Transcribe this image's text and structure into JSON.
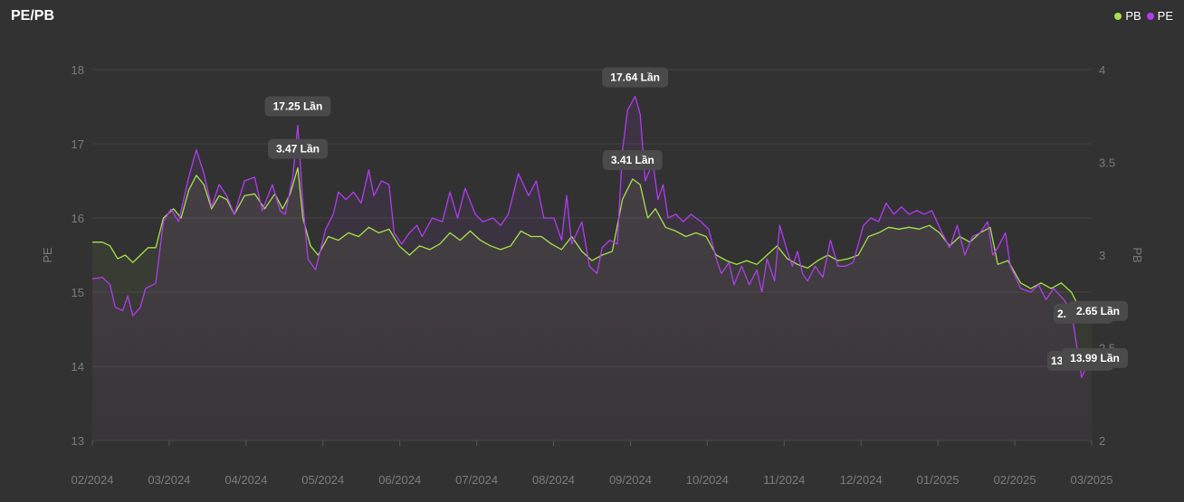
{
  "title": "PE/PB",
  "legend": [
    {
      "name": "PB",
      "color": "#a6e34a"
    },
    {
      "name": "PE",
      "color": "#b03cf0"
    }
  ],
  "chart_data": {
    "type": "line",
    "title": "PE/PB",
    "x_ticks": [
      "02/2024",
      "03/2024",
      "04/2024",
      "05/2024",
      "06/2024",
      "07/2024",
      "08/2024",
      "09/2024",
      "10/2024",
      "11/2024",
      "12/2024",
      "01/2025",
      "02/2025",
      "03/2025"
    ],
    "x_range": [
      "2024-02-01",
      "2025-03-01"
    ],
    "y_left": {
      "label": "PE",
      "ticks": [
        13,
        14,
        15,
        16,
        17,
        18
      ],
      "range": [
        13,
        18
      ]
    },
    "y_right": {
      "label": "PB",
      "ticks": [
        "2",
        "2.5",
        "3",
        "3.5",
        "4"
      ],
      "range": [
        2,
        4
      ]
    },
    "grid": true,
    "legend_position": "top-right",
    "series": [
      {
        "name": "PE",
        "axis": "left",
        "color": "#b03cf0",
        "points": [
          [
            "2024-02-01",
            15.18
          ],
          [
            "2024-02-05",
            15.2
          ],
          [
            "2024-02-08",
            15.1
          ],
          [
            "2024-02-10",
            14.8
          ],
          [
            "2024-02-13",
            14.75
          ],
          [
            "2024-02-15",
            14.95
          ],
          [
            "2024-02-17",
            14.68
          ],
          [
            "2024-02-20",
            14.8
          ],
          [
            "2024-02-22",
            15.05
          ],
          [
            "2024-02-26",
            15.12
          ],
          [
            "2024-02-29",
            15.95
          ],
          [
            "2024-03-03",
            16.12
          ],
          [
            "2024-03-06",
            15.95
          ],
          [
            "2024-03-10",
            16.55
          ],
          [
            "2024-03-13",
            16.92
          ],
          [
            "2024-03-16",
            16.6
          ],
          [
            "2024-03-19",
            16.15
          ],
          [
            "2024-03-22",
            16.45
          ],
          [
            "2024-03-25",
            16.3
          ],
          [
            "2024-03-28",
            16.05
          ],
          [
            "2024-04-01",
            16.5
          ],
          [
            "2024-04-05",
            16.55
          ],
          [
            "2024-04-08",
            16.1
          ],
          [
            "2024-04-12",
            16.45
          ],
          [
            "2024-04-15",
            16.1
          ],
          [
            "2024-04-17",
            16.05
          ],
          [
            "2024-04-20",
            16.55
          ],
          [
            "2024-04-22",
            17.25
          ],
          [
            "2024-04-24",
            16.2
          ],
          [
            "2024-04-26",
            15.45
          ],
          [
            "2024-04-29",
            15.3
          ],
          [
            "2024-05-03",
            15.85
          ],
          [
            "2024-05-06",
            16.05
          ],
          [
            "2024-05-08",
            16.35
          ],
          [
            "2024-05-11",
            16.25
          ],
          [
            "2024-05-14",
            16.35
          ],
          [
            "2024-05-17",
            16.2
          ],
          [
            "2024-05-20",
            16.65
          ],
          [
            "2024-05-22",
            16.3
          ],
          [
            "2024-05-25",
            16.5
          ],
          [
            "2024-05-28",
            16.45
          ],
          [
            "2024-05-30",
            15.8
          ],
          [
            "2024-06-02",
            15.65
          ],
          [
            "2024-06-05",
            15.8
          ],
          [
            "2024-06-08",
            15.9
          ],
          [
            "2024-06-10",
            15.75
          ],
          [
            "2024-06-14",
            16.0
          ],
          [
            "2024-06-18",
            15.95
          ],
          [
            "2024-06-21",
            16.35
          ],
          [
            "2024-06-24",
            16.0
          ],
          [
            "2024-06-27",
            16.4
          ],
          [
            "2024-07-01",
            16.05
          ],
          [
            "2024-07-04",
            15.95
          ],
          [
            "2024-07-08",
            16.0
          ],
          [
            "2024-07-11",
            15.9
          ],
          [
            "2024-07-14",
            16.05
          ],
          [
            "2024-07-18",
            16.6
          ],
          [
            "2024-07-22",
            16.3
          ],
          [
            "2024-07-25",
            16.5
          ],
          [
            "2024-07-28",
            16.0
          ],
          [
            "2024-08-01",
            16.0
          ],
          [
            "2024-08-04",
            15.7
          ],
          [
            "2024-08-06",
            16.3
          ],
          [
            "2024-08-08",
            15.65
          ],
          [
            "2024-08-12",
            15.95
          ],
          [
            "2024-08-15",
            15.35
          ],
          [
            "2024-08-18",
            15.25
          ],
          [
            "2024-08-20",
            15.6
          ],
          [
            "2024-08-23",
            15.7
          ],
          [
            "2024-08-26",
            15.65
          ],
          [
            "2024-08-28",
            16.9
          ],
          [
            "2024-08-30",
            17.45
          ],
          [
            "2024-09-02",
            17.64
          ],
          [
            "2024-09-04",
            17.4
          ],
          [
            "2024-09-06",
            16.5
          ],
          [
            "2024-09-09",
            16.75
          ],
          [
            "2024-09-11",
            16.25
          ],
          [
            "2024-09-13",
            16.45
          ],
          [
            "2024-09-15",
            16.0
          ],
          [
            "2024-09-18",
            16.05
          ],
          [
            "2024-09-21",
            15.95
          ],
          [
            "2024-09-24",
            16.05
          ],
          [
            "2024-09-28",
            15.95
          ],
          [
            "2024-10-01",
            15.85
          ],
          [
            "2024-10-04",
            15.45
          ],
          [
            "2024-10-06",
            15.25
          ],
          [
            "2024-10-09",
            15.4
          ],
          [
            "2024-10-11",
            15.1
          ],
          [
            "2024-10-14",
            15.35
          ],
          [
            "2024-10-17",
            15.1
          ],
          [
            "2024-10-20",
            15.3
          ],
          [
            "2024-10-22",
            15.0
          ],
          [
            "2024-10-24",
            15.45
          ],
          [
            "2024-10-27",
            15.15
          ],
          [
            "2024-10-29",
            15.9
          ],
          [
            "2024-11-01",
            15.55
          ],
          [
            "2024-11-03",
            15.35
          ],
          [
            "2024-11-05",
            15.55
          ],
          [
            "2024-11-07",
            15.25
          ],
          [
            "2024-11-09",
            15.15
          ],
          [
            "2024-11-12",
            15.35
          ],
          [
            "2024-11-15",
            15.2
          ],
          [
            "2024-11-18",
            15.7
          ],
          [
            "2024-11-21",
            15.35
          ],
          [
            "2024-11-24",
            15.35
          ],
          [
            "2024-11-27",
            15.4
          ],
          [
            "2024-12-01",
            15.9
          ],
          [
            "2024-12-04",
            16.0
          ],
          [
            "2024-12-07",
            15.95
          ],
          [
            "2024-12-10",
            16.2
          ],
          [
            "2024-12-13",
            16.05
          ],
          [
            "2024-12-16",
            16.15
          ],
          [
            "2024-12-19",
            16.05
          ],
          [
            "2024-12-22",
            16.1
          ],
          [
            "2024-12-25",
            16.05
          ],
          [
            "2024-12-28",
            16.1
          ],
          [
            "2025-01-01",
            15.8
          ],
          [
            "2025-01-04",
            15.6
          ],
          [
            "2025-01-07",
            15.9
          ],
          [
            "2025-01-10",
            15.5
          ],
          [
            "2025-01-13",
            15.75
          ],
          [
            "2025-01-16",
            15.8
          ],
          [
            "2025-01-19",
            15.95
          ],
          [
            "2025-01-21",
            15.5
          ],
          [
            "2025-01-23",
            15.6
          ],
          [
            "2025-01-26",
            15.8
          ],
          [
            "2025-01-28",
            15.35
          ],
          [
            "2025-02-01",
            15.05
          ],
          [
            "2025-02-05",
            15.0
          ],
          [
            "2025-02-08",
            15.1
          ],
          [
            "2025-02-11",
            14.9
          ],
          [
            "2025-02-14",
            15.05
          ],
          [
            "2025-02-18",
            14.9
          ],
          [
            "2025-02-21",
            14.75
          ],
          [
            "2025-02-23",
            14.3
          ],
          [
            "2025-02-25",
            13.85
          ],
          [
            "2025-02-27",
            14.0
          ],
          [
            "2025-03-01",
            14.02
          ]
        ]
      },
      {
        "name": "PB",
        "axis": "right",
        "color": "#a6e34a",
        "points": [
          [
            "2024-02-01",
            3.07
          ],
          [
            "2024-02-05",
            3.07
          ],
          [
            "2024-02-08",
            3.05
          ],
          [
            "2024-02-11",
            2.98
          ],
          [
            "2024-02-14",
            3.0
          ],
          [
            "2024-02-17",
            2.96
          ],
          [
            "2024-02-20",
            3.0
          ],
          [
            "2024-02-23",
            3.04
          ],
          [
            "2024-02-26",
            3.04
          ],
          [
            "2024-02-29",
            3.2
          ],
          [
            "2024-03-04",
            3.25
          ],
          [
            "2024-03-07",
            3.2
          ],
          [
            "2024-03-10",
            3.35
          ],
          [
            "2024-03-13",
            3.43
          ],
          [
            "2024-03-16",
            3.38
          ],
          [
            "2024-03-19",
            3.25
          ],
          [
            "2024-03-22",
            3.32
          ],
          [
            "2024-03-25",
            3.3
          ],
          [
            "2024-03-28",
            3.22
          ],
          [
            "2024-04-01",
            3.32
          ],
          [
            "2024-04-05",
            3.33
          ],
          [
            "2024-04-09",
            3.25
          ],
          [
            "2024-04-13",
            3.33
          ],
          [
            "2024-04-16",
            3.25
          ],
          [
            "2024-04-19",
            3.33
          ],
          [
            "2024-04-22",
            3.47
          ],
          [
            "2024-04-24",
            3.2
          ],
          [
            "2024-04-27",
            3.05
          ],
          [
            "2024-04-30",
            3.0
          ],
          [
            "2024-05-04",
            3.1
          ],
          [
            "2024-05-08",
            3.08
          ],
          [
            "2024-05-12",
            3.12
          ],
          [
            "2024-05-16",
            3.1
          ],
          [
            "2024-05-20",
            3.15
          ],
          [
            "2024-05-24",
            3.12
          ],
          [
            "2024-05-28",
            3.14
          ],
          [
            "2024-06-01",
            3.05
          ],
          [
            "2024-06-05",
            3.0
          ],
          [
            "2024-06-09",
            3.05
          ],
          [
            "2024-06-13",
            3.03
          ],
          [
            "2024-06-17",
            3.06
          ],
          [
            "2024-06-21",
            3.12
          ],
          [
            "2024-06-25",
            3.08
          ],
          [
            "2024-06-29",
            3.13
          ],
          [
            "2024-07-03",
            3.08
          ],
          [
            "2024-07-07",
            3.05
          ],
          [
            "2024-07-11",
            3.03
          ],
          [
            "2024-07-15",
            3.05
          ],
          [
            "2024-07-19",
            3.13
          ],
          [
            "2024-07-23",
            3.1
          ],
          [
            "2024-07-27",
            3.1
          ],
          [
            "2024-07-31",
            3.06
          ],
          [
            "2024-08-04",
            3.03
          ],
          [
            "2024-08-08",
            3.1
          ],
          [
            "2024-08-12",
            3.02
          ],
          [
            "2024-08-16",
            2.97
          ],
          [
            "2024-08-20",
            3.0
          ],
          [
            "2024-08-24",
            3.02
          ],
          [
            "2024-08-28",
            3.3
          ],
          [
            "2024-09-01",
            3.41
          ],
          [
            "2024-09-04",
            3.38
          ],
          [
            "2024-09-07",
            3.2
          ],
          [
            "2024-09-10",
            3.25
          ],
          [
            "2024-09-14",
            3.15
          ],
          [
            "2024-09-18",
            3.13
          ],
          [
            "2024-09-22",
            3.1
          ],
          [
            "2024-09-26",
            3.12
          ],
          [
            "2024-09-30",
            3.1
          ],
          [
            "2024-10-04",
            3.0
          ],
          [
            "2024-10-08",
            2.97
          ],
          [
            "2024-10-12",
            2.95
          ],
          [
            "2024-10-16",
            2.97
          ],
          [
            "2024-10-20",
            2.95
          ],
          [
            "2024-10-24",
            3.0
          ],
          [
            "2024-10-28",
            3.05
          ],
          [
            "2024-11-01",
            2.98
          ],
          [
            "2024-11-05",
            2.95
          ],
          [
            "2024-11-09",
            2.93
          ],
          [
            "2024-11-13",
            2.97
          ],
          [
            "2024-11-17",
            3.0
          ],
          [
            "2024-11-21",
            2.97
          ],
          [
            "2024-11-25",
            2.98
          ],
          [
            "2024-11-29",
            3.0
          ],
          [
            "2024-12-03",
            3.1
          ],
          [
            "2024-12-07",
            3.12
          ],
          [
            "2024-12-11",
            3.15
          ],
          [
            "2024-12-15",
            3.14
          ],
          [
            "2024-12-19",
            3.15
          ],
          [
            "2024-12-23",
            3.14
          ],
          [
            "2024-12-27",
            3.16
          ],
          [
            "2024-12-31",
            3.12
          ],
          [
            "2025-01-04",
            3.05
          ],
          [
            "2025-01-08",
            3.1
          ],
          [
            "2025-01-12",
            3.07
          ],
          [
            "2025-01-16",
            3.12
          ],
          [
            "2025-01-20",
            3.15
          ],
          [
            "2025-01-23",
            2.95
          ],
          [
            "2025-01-27",
            2.97
          ],
          [
            "2025-02-01",
            2.85
          ],
          [
            "2025-02-05",
            2.82
          ],
          [
            "2025-02-09",
            2.85
          ],
          [
            "2025-02-13",
            2.82
          ],
          [
            "2025-02-17",
            2.85
          ],
          [
            "2025-02-21",
            2.8
          ],
          [
            "2025-02-24",
            2.72
          ],
          [
            "2025-02-27",
            2.64
          ],
          [
            "2025-03-01",
            2.65
          ]
        ]
      }
    ],
    "annotations": [
      {
        "series": "PE",
        "date": "2024-04-22",
        "value": 17.25,
        "label": "17.25 Lần"
      },
      {
        "series": "PB",
        "date": "2024-04-22",
        "value": 3.47,
        "label": "3.47 Lần"
      },
      {
        "series": "PE",
        "date": "2024-09-02",
        "value": 17.64,
        "label": "17.64 Lần"
      },
      {
        "series": "PB",
        "date": "2024-09-01",
        "value": 3.41,
        "label": "3.41 Lần"
      },
      {
        "series": "PB",
        "date": "2025-03-01",
        "value": 2.65,
        "label": "2.65 Lần",
        "stub": "2."
      },
      {
        "series": "PE",
        "date": "2025-03-01",
        "value": 13.99,
        "label": "13.99 Lần",
        "stub": "13"
      }
    ]
  }
}
